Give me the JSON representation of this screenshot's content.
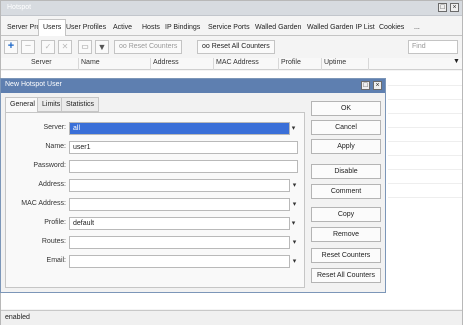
{
  "main": {
    "title": "Hotspot",
    "tabs": [
      "Server Profiles",
      "Users",
      "User Profiles",
      "Active",
      "Hosts",
      "IP Bindings",
      "Service Ports",
      "Walled Garden",
      "Walled Garden IP List",
      "Cookies",
      "..."
    ],
    "active_tab": "Users",
    "toolbar": {
      "reset_counters": "Reset Counters",
      "reset_all_counters": "Reset All Counters",
      "find_placeholder": "Find"
    },
    "columns": [
      "Server",
      "Name",
      "Address",
      "MAC Address",
      "Profile",
      "Uptime"
    ],
    "status": "enabled"
  },
  "dialog": {
    "title": "New Hotspot User",
    "tabs": [
      "General",
      "Limits",
      "Statistics"
    ],
    "fields": [
      {
        "label": "Server:",
        "value": "all"
      },
      {
        "label": "Name:",
        "value": "user1"
      },
      {
        "label": "Password:",
        "value": ""
      },
      {
        "label": "Address:",
        "value": ""
      },
      {
        "label": "MAC Address:",
        "value": ""
      },
      {
        "label": "Profile:",
        "value": "default"
      },
      {
        "label": "Routes:",
        "value": ""
      },
      {
        "label": "Email:",
        "value": ""
      }
    ],
    "buttons": [
      "OK",
      "Cancel",
      "Apply",
      "Disable",
      "Comment",
      "Copy",
      "Remove",
      "Reset Counters",
      "Reset All Counters"
    ]
  }
}
